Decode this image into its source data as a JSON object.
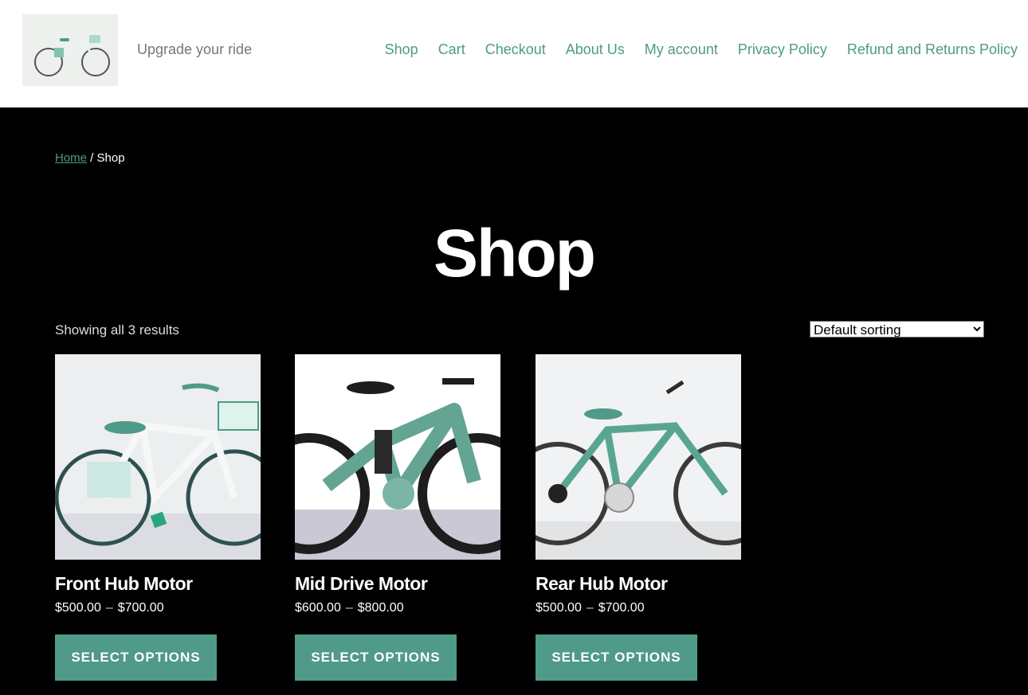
{
  "site": {
    "tagline": "Upgrade your ride",
    "brand_color": "#4f9a88"
  },
  "nav": {
    "items": [
      {
        "label": "Shop"
      },
      {
        "label": "Cart"
      },
      {
        "label": "Checkout"
      },
      {
        "label": "About Us"
      },
      {
        "label": "My account"
      },
      {
        "label": "Privacy Policy"
      },
      {
        "label": "Refund and Returns Policy"
      }
    ]
  },
  "breadcrumb": {
    "home": "Home",
    "separator": " / ",
    "current": "Shop"
  },
  "page": {
    "title": "Shop",
    "result_count": "Showing all 3 results",
    "sorting": {
      "selected": "Default sorting"
    }
  },
  "products": [
    {
      "name": "Front Hub Motor",
      "price_min": "$500.00",
      "price_sep": "–",
      "price_max": "$700.00",
      "button": "Select options",
      "image_icon": "white-city-bike-icon"
    },
    {
      "name": "Mid Drive Motor",
      "price_min": "$600.00",
      "price_sep": "–",
      "price_max": "$800.00",
      "button": "Select options",
      "image_icon": "mountain-bike-icon"
    },
    {
      "name": "Rear Hub Motor",
      "price_min": "$500.00",
      "price_sep": "–",
      "price_max": "$700.00",
      "button": "Select options",
      "image_icon": "green-bike-icon"
    }
  ]
}
